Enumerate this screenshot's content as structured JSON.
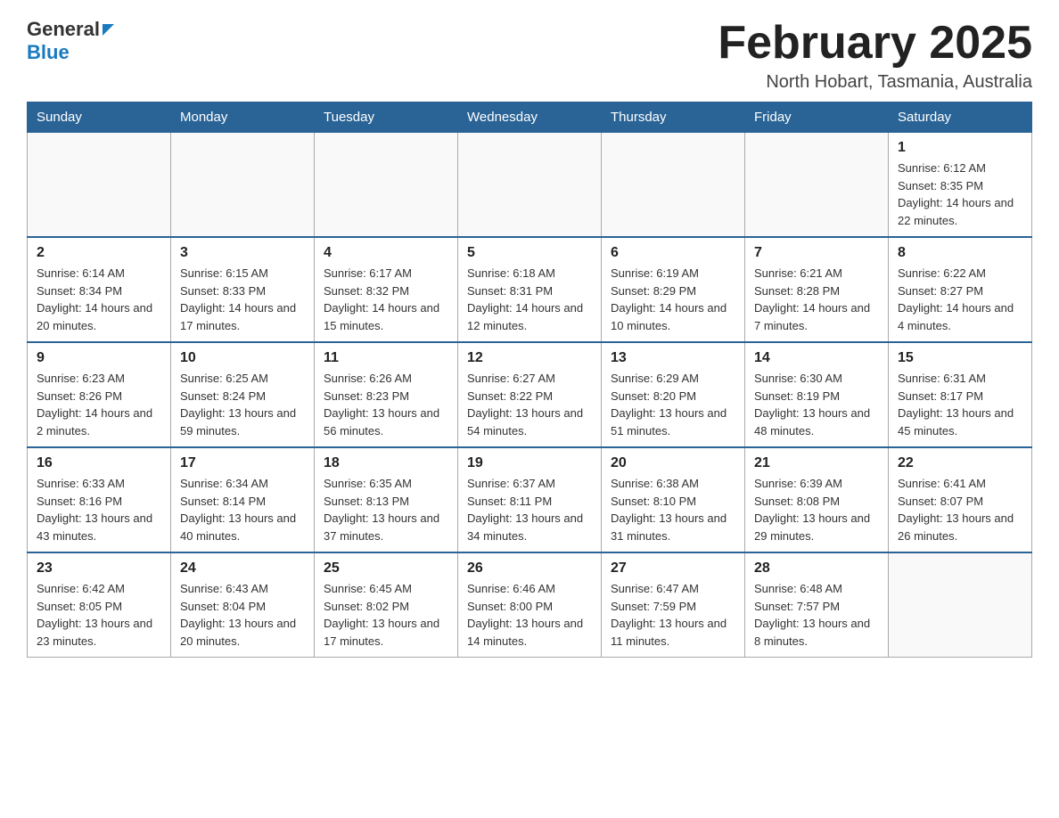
{
  "header": {
    "logo_general": "General",
    "logo_blue": "Blue",
    "month_title": "February 2025",
    "location": "North Hobart, Tasmania, Australia"
  },
  "weekdays": [
    "Sunday",
    "Monday",
    "Tuesday",
    "Wednesday",
    "Thursday",
    "Friday",
    "Saturday"
  ],
  "weeks": [
    [
      {
        "day": "",
        "info": ""
      },
      {
        "day": "",
        "info": ""
      },
      {
        "day": "",
        "info": ""
      },
      {
        "day": "",
        "info": ""
      },
      {
        "day": "",
        "info": ""
      },
      {
        "day": "",
        "info": ""
      },
      {
        "day": "1",
        "info": "Sunrise: 6:12 AM\nSunset: 8:35 PM\nDaylight: 14 hours and 22 minutes."
      }
    ],
    [
      {
        "day": "2",
        "info": "Sunrise: 6:14 AM\nSunset: 8:34 PM\nDaylight: 14 hours and 20 minutes."
      },
      {
        "day": "3",
        "info": "Sunrise: 6:15 AM\nSunset: 8:33 PM\nDaylight: 14 hours and 17 minutes."
      },
      {
        "day": "4",
        "info": "Sunrise: 6:17 AM\nSunset: 8:32 PM\nDaylight: 14 hours and 15 minutes."
      },
      {
        "day": "5",
        "info": "Sunrise: 6:18 AM\nSunset: 8:31 PM\nDaylight: 14 hours and 12 minutes."
      },
      {
        "day": "6",
        "info": "Sunrise: 6:19 AM\nSunset: 8:29 PM\nDaylight: 14 hours and 10 minutes."
      },
      {
        "day": "7",
        "info": "Sunrise: 6:21 AM\nSunset: 8:28 PM\nDaylight: 14 hours and 7 minutes."
      },
      {
        "day": "8",
        "info": "Sunrise: 6:22 AM\nSunset: 8:27 PM\nDaylight: 14 hours and 4 minutes."
      }
    ],
    [
      {
        "day": "9",
        "info": "Sunrise: 6:23 AM\nSunset: 8:26 PM\nDaylight: 14 hours and 2 minutes."
      },
      {
        "day": "10",
        "info": "Sunrise: 6:25 AM\nSunset: 8:24 PM\nDaylight: 13 hours and 59 minutes."
      },
      {
        "day": "11",
        "info": "Sunrise: 6:26 AM\nSunset: 8:23 PM\nDaylight: 13 hours and 56 minutes."
      },
      {
        "day": "12",
        "info": "Sunrise: 6:27 AM\nSunset: 8:22 PM\nDaylight: 13 hours and 54 minutes."
      },
      {
        "day": "13",
        "info": "Sunrise: 6:29 AM\nSunset: 8:20 PM\nDaylight: 13 hours and 51 minutes."
      },
      {
        "day": "14",
        "info": "Sunrise: 6:30 AM\nSunset: 8:19 PM\nDaylight: 13 hours and 48 minutes."
      },
      {
        "day": "15",
        "info": "Sunrise: 6:31 AM\nSunset: 8:17 PM\nDaylight: 13 hours and 45 minutes."
      }
    ],
    [
      {
        "day": "16",
        "info": "Sunrise: 6:33 AM\nSunset: 8:16 PM\nDaylight: 13 hours and 43 minutes."
      },
      {
        "day": "17",
        "info": "Sunrise: 6:34 AM\nSunset: 8:14 PM\nDaylight: 13 hours and 40 minutes."
      },
      {
        "day": "18",
        "info": "Sunrise: 6:35 AM\nSunset: 8:13 PM\nDaylight: 13 hours and 37 minutes."
      },
      {
        "day": "19",
        "info": "Sunrise: 6:37 AM\nSunset: 8:11 PM\nDaylight: 13 hours and 34 minutes."
      },
      {
        "day": "20",
        "info": "Sunrise: 6:38 AM\nSunset: 8:10 PM\nDaylight: 13 hours and 31 minutes."
      },
      {
        "day": "21",
        "info": "Sunrise: 6:39 AM\nSunset: 8:08 PM\nDaylight: 13 hours and 29 minutes."
      },
      {
        "day": "22",
        "info": "Sunrise: 6:41 AM\nSunset: 8:07 PM\nDaylight: 13 hours and 26 minutes."
      }
    ],
    [
      {
        "day": "23",
        "info": "Sunrise: 6:42 AM\nSunset: 8:05 PM\nDaylight: 13 hours and 23 minutes."
      },
      {
        "day": "24",
        "info": "Sunrise: 6:43 AM\nSunset: 8:04 PM\nDaylight: 13 hours and 20 minutes."
      },
      {
        "day": "25",
        "info": "Sunrise: 6:45 AM\nSunset: 8:02 PM\nDaylight: 13 hours and 17 minutes."
      },
      {
        "day": "26",
        "info": "Sunrise: 6:46 AM\nSunset: 8:00 PM\nDaylight: 13 hours and 14 minutes."
      },
      {
        "day": "27",
        "info": "Sunrise: 6:47 AM\nSunset: 7:59 PM\nDaylight: 13 hours and 11 minutes."
      },
      {
        "day": "28",
        "info": "Sunrise: 6:48 AM\nSunset: 7:57 PM\nDaylight: 13 hours and 8 minutes."
      },
      {
        "day": "",
        "info": ""
      }
    ]
  ]
}
